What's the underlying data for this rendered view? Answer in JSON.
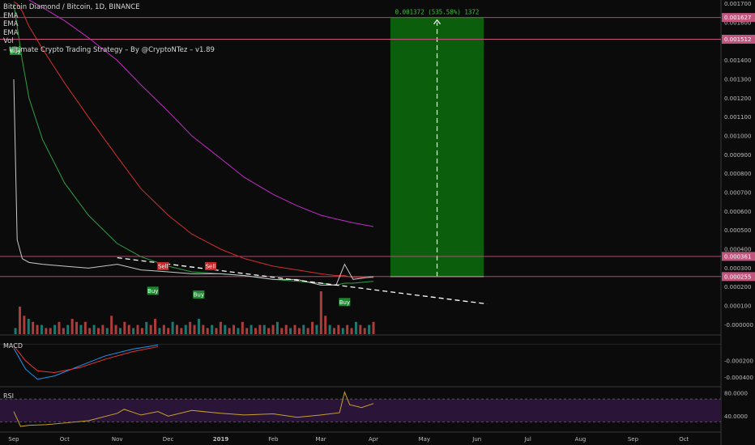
{
  "legend": {
    "symbol_line": "Bitcoin Diamond / Bitcoin, 1D, BINANCE",
    "ema1": "EMA",
    "ema2": "EMA",
    "ema3": "EMA",
    "vol": "Vol",
    "strategy": "– Ultimate Crypto Trading Strategy – By @CryptoNTez – v1.89"
  },
  "panes": {
    "macd_label": "MACD",
    "rsi_label": "RSI"
  },
  "colors": {
    "background": "#0b0b0b",
    "candle_up": "#26a69a",
    "candle_down": "#ef5350",
    "ema_green": "#2ea043",
    "ema_red": "#d32f2f",
    "ema_magenta": "#c42bc7",
    "target_box": "#0b5e0b",
    "level_line": "#c0557d",
    "rsi_line": "#c8a12a",
    "rsi_band": "#2a1538"
  },
  "chart_data": [
    {
      "type": "line",
      "pane": "price",
      "title": "Bitcoin Diamond / Bitcoin, 1D, BINANCE",
      "x_ticks": [
        "Sep",
        "Oct",
        "Nov",
        "Dec",
        "2019",
        "Feb",
        "Mar",
        "Apr",
        "May",
        "Jun",
        "Jul",
        "Aug",
        "Sep",
        "Oct"
      ],
      "y_ticks": [
        "0.001700",
        "0.001600",
        "0.001500",
        "0.001400",
        "0.001300",
        "0.001200",
        "0.001100",
        "0.001000",
        "0.000900",
        "0.000800",
        "0.000700",
        "0.000600",
        "0.000500",
        "0.000400",
        "0.000300",
        "0.000200",
        "0.000100",
        "-0.000000"
      ],
      "ylim": [
        -5e-05,
        0.00172
      ],
      "x_dates": [
        "2018-09-01",
        "2018-09-03",
        "2018-09-06",
        "2018-09-10",
        "2018-09-18",
        "2018-10-01",
        "2018-10-15",
        "2018-11-01",
        "2018-11-15",
        "2018-12-01",
        "2018-12-15",
        "2019-01-01",
        "2019-01-15",
        "2019-02-01",
        "2019-02-15",
        "2019-03-01",
        "2019-03-10",
        "2019-03-15",
        "2019-03-20",
        "2019-04-01"
      ],
      "price": [
        0.0013,
        0.00045,
        0.00035,
        0.00033,
        0.00032,
        0.00031,
        0.0003,
        0.00032,
        0.00029,
        0.00028,
        0.00027,
        0.00027,
        0.00026,
        0.00024,
        0.00024,
        0.00021,
        0.00021,
        0.00032,
        0.00024,
        0.000255
      ],
      "ema_green": [
        0.0017,
        0.00158,
        0.0014,
        0.0012,
        0.00098,
        0.00075,
        0.00058,
        0.00043,
        0.00036,
        0.00031,
        0.00028,
        0.00027,
        0.00026,
        0.00024,
        0.00023,
        0.00022,
        0.00021,
        0.00022,
        0.00022,
        0.00023
      ],
      "ema_red": [
        0.00171,
        0.0017,
        0.00166,
        0.00158,
        0.00146,
        0.00128,
        0.0011,
        0.00089,
        0.00072,
        0.00058,
        0.00048,
        0.0004,
        0.00035,
        0.00031,
        0.00029,
        0.00027,
        0.00026,
        0.00026,
        0.00025,
        0.00025
      ],
      "ema_magenta": [
        null,
        null,
        null,
        0.00172,
        0.00168,
        0.00161,
        0.00152,
        0.0014,
        0.00127,
        0.00113,
        0.001,
        0.00088,
        0.00078,
        0.00069,
        0.00063,
        0.00058,
        0.00056,
        0.00055,
        0.00054,
        0.00052
      ],
      "trendline": {
        "from": {
          "x": "2018-11-01",
          "y": 0.000355
        },
        "to": {
          "x": "2019-06-07",
          "y": 0.00011
        }
      },
      "levels": [
        {
          "value": 0.00162726,
          "label": "0.001627"
        },
        {
          "value": 0.00151213,
          "label": "0.001512"
        },
        {
          "value": 0.00036188,
          "label": "0.000361"
        },
        {
          "value": 0.00025503,
          "label": "0.000255"
        }
      ],
      "target_box": {
        "x_start": "2019-04-11",
        "x_end": "2019-06-05",
        "y_low": 0.000255,
        "y_high": 0.001627,
        "label": "0.001372 (535.58%) 1372"
      },
      "signals": [
        {
          "type": "Buy",
          "x": "2018-09-02",
          "y": 0.00145
        },
        {
          "type": "Sell",
          "x": "2018-11-28",
          "y": 0.00031
        },
        {
          "type": "Sell",
          "x": "2018-12-26",
          "y": 0.00031
        },
        {
          "type": "Buy",
          "x": "2018-11-22",
          "y": 0.00018
        },
        {
          "type": "Buy",
          "x": "2018-12-19",
          "y": 0.00016
        },
        {
          "type": "Buy",
          "x": "2019-03-15",
          "y": 0.00012
        }
      ]
    },
    {
      "type": "bar",
      "pane": "volume",
      "series": [
        {
          "values": [
            2,
            9,
            6,
            5,
            4,
            3,
            3,
            2,
            2,
            3,
            4,
            2,
            3,
            5,
            4,
            3,
            4,
            2,
            3,
            2,
            3,
            2,
            6,
            3,
            2,
            4,
            3,
            2,
            3,
            2,
            4,
            3,
            5,
            2,
            3,
            2,
            4,
            3,
            2,
            3,
            4,
            3,
            5,
            3,
            2,
            3,
            2,
            4,
            3,
            2,
            3,
            2,
            4,
            2,
            3,
            2,
            3,
            3,
            2,
            3,
            4,
            2,
            3,
            2,
            3,
            2,
            3,
            2,
            4,
            3,
            14,
            6,
            3,
            2,
            3,
            2,
            3,
            2,
            4,
            3,
            2,
            3,
            4
          ]
        }
      ]
    },
    {
      "type": "line",
      "pane": "macd",
      "title": "MACD",
      "y_ticks": [
        "-0.000200",
        "-0.000400"
      ],
      "ylim": [
        -0.0005,
        0.0001
      ],
      "x_dates": [
        "2018-09-01",
        "2018-09-08",
        "2018-09-15",
        "2018-09-25",
        "2018-10-10",
        "2018-10-25",
        "2018-11-10",
        "2018-11-25"
      ],
      "series": [
        {
          "values": [
            -5e-05,
            -0.0003,
            -0.00042,
            -0.00038,
            -0.00026,
            -0.00014,
            -6e-05,
            -1e-05
          ]
        },
        {
          "values": [
            -2e-05,
            -0.0002,
            -0.00032,
            -0.00034,
            -0.00028,
            -0.00018,
            -9e-05,
            -3e-05
          ]
        }
      ]
    },
    {
      "type": "line",
      "pane": "rsi",
      "title": "RSI",
      "y_ticks": [
        "80.0000",
        "40.0000"
      ],
      "ylim": [
        15,
        90
      ],
      "bands": [
        70,
        30
      ],
      "x_dates": [
        "2018-09-01",
        "2018-09-05",
        "2018-09-10",
        "2018-09-20",
        "2018-10-01",
        "2018-10-15",
        "2018-11-01",
        "2018-11-05",
        "2018-11-15",
        "2018-11-25",
        "2018-12-01",
        "2018-12-15",
        "2019-01-01",
        "2019-01-15",
        "2019-02-01",
        "2019-02-15",
        "2019-03-01",
        "2019-03-12",
        "2019-03-15",
        "2019-03-18",
        "2019-03-25",
        "2019-04-01"
      ],
      "series": [
        {
          "values": [
            48,
            22,
            24,
            25,
            28,
            32,
            45,
            52,
            42,
            48,
            40,
            50,
            45,
            42,
            44,
            38,
            42,
            46,
            82,
            60,
            55,
            62
          ]
        }
      ]
    }
  ]
}
